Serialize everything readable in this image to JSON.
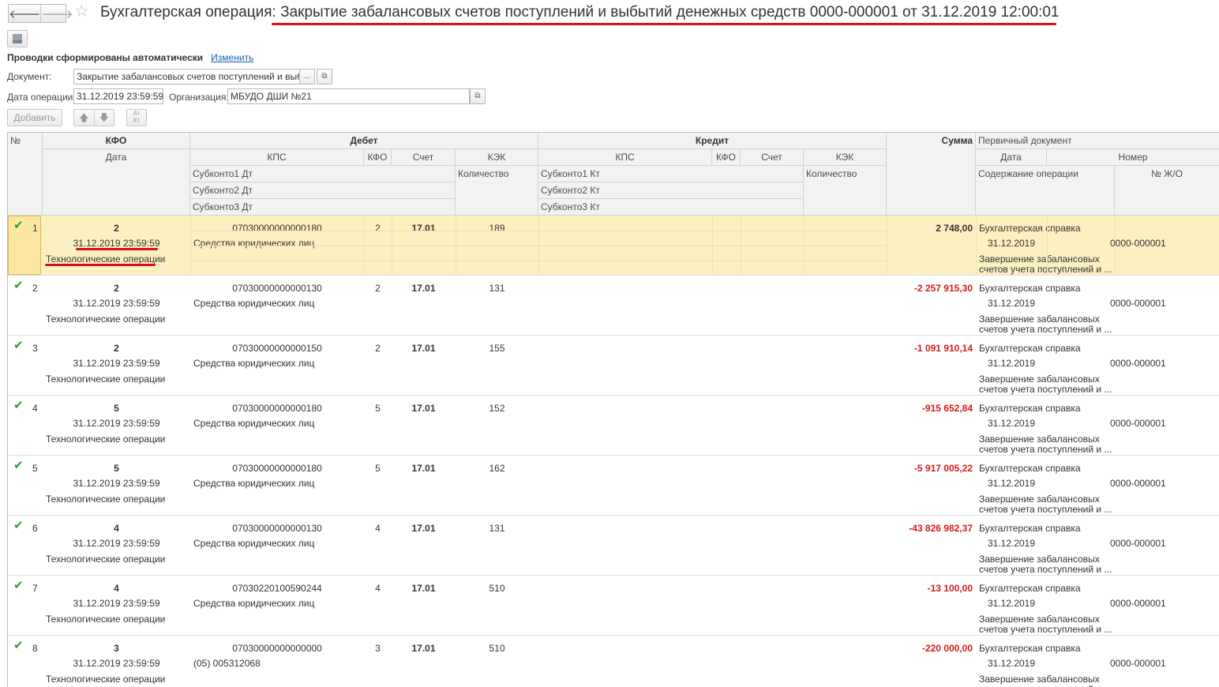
{
  "window": {
    "title_prefix": "Бухгалтерская операция: ",
    "title_main": "Закрытие забалансовых счетов поступлений и выбытий денежных средств 0000-000001 от 31.12.2019 12:00:01",
    "back_glyph": "🡐",
    "forward_glyph": "🡒",
    "star_glyph": "☆"
  },
  "header": {
    "auto_text": "Проводки сформированы автоматически",
    "change_link": "Изменить",
    "document_label": "Документ:",
    "document_value": "Закрытие забалансовых счетов поступлений и выбыти",
    "ellipsis": "...",
    "open_glyph": "⧉",
    "date_label": "Дата операции:",
    "date_value": "31.12.2019 23:59:59",
    "org_label": "Организация:",
    "org_value": "МБУДО ДШИ  №21",
    "add_button": "Добавить",
    "up_glyph": "🡅",
    "down_glyph": "🡇",
    "sort_glyph": "Ат\nКт"
  },
  "columns": {
    "num": "№",
    "kfo": "КФО",
    "date": "Дата",
    "debit": "Дебет",
    "credit": "Кредит",
    "kps": "КПС",
    "kfo_short": "КФО",
    "account": "Счет",
    "kek": "КЭК",
    "sub1_dt": "Субконто1 Дт",
    "sub2_dt": "Субконто2 Дт",
    "sub3_dt": "Субконто3 Дт",
    "qty": "Количество",
    "sub1_kt": "Субконто1 Кт",
    "sub2_kt": "Субконто2 Кт",
    "sub3_kt": "Субконто3 Кт",
    "sum": "Сумма",
    "primary_doc": "Первичный документ",
    "doc_date": "Дата",
    "doc_number": "Номер",
    "content": "Содержание операции",
    "journal_num": "№ Ж/О"
  },
  "rows": [
    {
      "n": "1",
      "kfo": "2",
      "date": "31.12.2019 23:59:59",
      "op": "Технологические операции",
      "kps": "07030000000000180",
      "kfo_d": "2",
      "acc": "17.01",
      "kek": "189",
      "sub1": "Средства юридических лиц",
      "sum": "2 748,00",
      "neg": false,
      "doc": "Бухгалтерская справка",
      "doc_date": "31.12.2019",
      "doc_num": "0000-000001",
      "content1": "Завершение забалансовых",
      "content2": "счетов учета поступлений и ..."
    },
    {
      "n": "2",
      "kfo": "2",
      "date": "31.12.2019 23:59:59",
      "op": "Технологические операции",
      "kps": "07030000000000130",
      "kfo_d": "2",
      "acc": "17.01",
      "kek": "131",
      "sub1": "Средства юридических лиц",
      "sum": "-2 257 915,30",
      "neg": true,
      "doc": "Бухгалтерская справка",
      "doc_date": "31.12.2019",
      "doc_num": "0000-000001",
      "content1": "Завершение забалансовых",
      "content2": "счетов учета поступлений и ..."
    },
    {
      "n": "3",
      "kfo": "2",
      "date": "31.12.2019 23:59:59",
      "op": "Технологические операции",
      "kps": "07030000000000150",
      "kfo_d": "2",
      "acc": "17.01",
      "kek": "155",
      "sub1": "Средства юридических лиц",
      "sum": "-1 091 910,14",
      "neg": true,
      "doc": "Бухгалтерская справка",
      "doc_date": "31.12.2019",
      "doc_num": "0000-000001",
      "content1": "Завершение забалансовых",
      "content2": "счетов учета поступлений и ..."
    },
    {
      "n": "4",
      "kfo": "5",
      "date": "31.12.2019 23:59:59",
      "op": "Технологические операции",
      "kps": "07030000000000180",
      "kfo_d": "5",
      "acc": "17.01",
      "kek": "152",
      "sub1": "Средства юридических лиц",
      "sum": "-915 652,84",
      "neg": true,
      "doc": "Бухгалтерская справка",
      "doc_date": "31.12.2019",
      "doc_num": "0000-000001",
      "content1": "Завершение забалансовых",
      "content2": "счетов учета поступлений и ..."
    },
    {
      "n": "5",
      "kfo": "5",
      "date": "31.12.2019 23:59:59",
      "op": "Технологические операции",
      "kps": "07030000000000180",
      "kfo_d": "5",
      "acc": "17.01",
      "kek": "162",
      "sub1": "Средства юридических лиц",
      "sum": "-5 917 005,22",
      "neg": true,
      "doc": "Бухгалтерская справка",
      "doc_date": "31.12.2019",
      "doc_num": "0000-000001",
      "content1": "Завершение забалансовых",
      "content2": "счетов учета поступлений и ..."
    },
    {
      "n": "6",
      "kfo": "4",
      "date": "31.12.2019 23:59:59",
      "op": "Технологические операции",
      "kps": "07030000000000130",
      "kfo_d": "4",
      "acc": "17.01",
      "kek": "131",
      "sub1": "Средства юридических лиц",
      "sum": "-43 826 982,37",
      "neg": true,
      "doc": "Бухгалтерская справка",
      "doc_date": "31.12.2019",
      "doc_num": "0000-000001",
      "content1": "Завершение забалансовых",
      "content2": "счетов учета поступлений и ..."
    },
    {
      "n": "7",
      "kfo": "4",
      "date": "31.12.2019 23:59:59",
      "op": "Технологические операции",
      "kps": "07030220100590244",
      "kfo_d": "4",
      "acc": "17.01",
      "kek": "510",
      "sub1": "Средства юридических лиц",
      "sum": "-13 100,00",
      "neg": true,
      "doc": "Бухгалтерская справка",
      "doc_date": "31.12.2019",
      "doc_num": "0000-000001",
      "content1": "Завершение забалансовых",
      "content2": "счетов учета поступлений и ..."
    },
    {
      "n": "8",
      "kfo": "3",
      "date": "31.12.2019 23:59:59",
      "op": "Технологические операции",
      "kps": "07030000000000000",
      "kfo_d": "3",
      "acc": "17.01",
      "kek": "510",
      "sub1": "(05) 005312068",
      "sum": "-220 000,00",
      "neg": true,
      "doc": "Бухгалтерская справка",
      "doc_date": "31.12.2019",
      "doc_num": "0000-000001",
      "content1": "Завершение забалансовых",
      "content2": "счетов учета поступлений и"
    }
  ],
  "colors": {
    "negative": "#d11b1b",
    "selected_row": "#fcefc0",
    "check": "#2a9a3a",
    "annotation": "#d9111c"
  }
}
